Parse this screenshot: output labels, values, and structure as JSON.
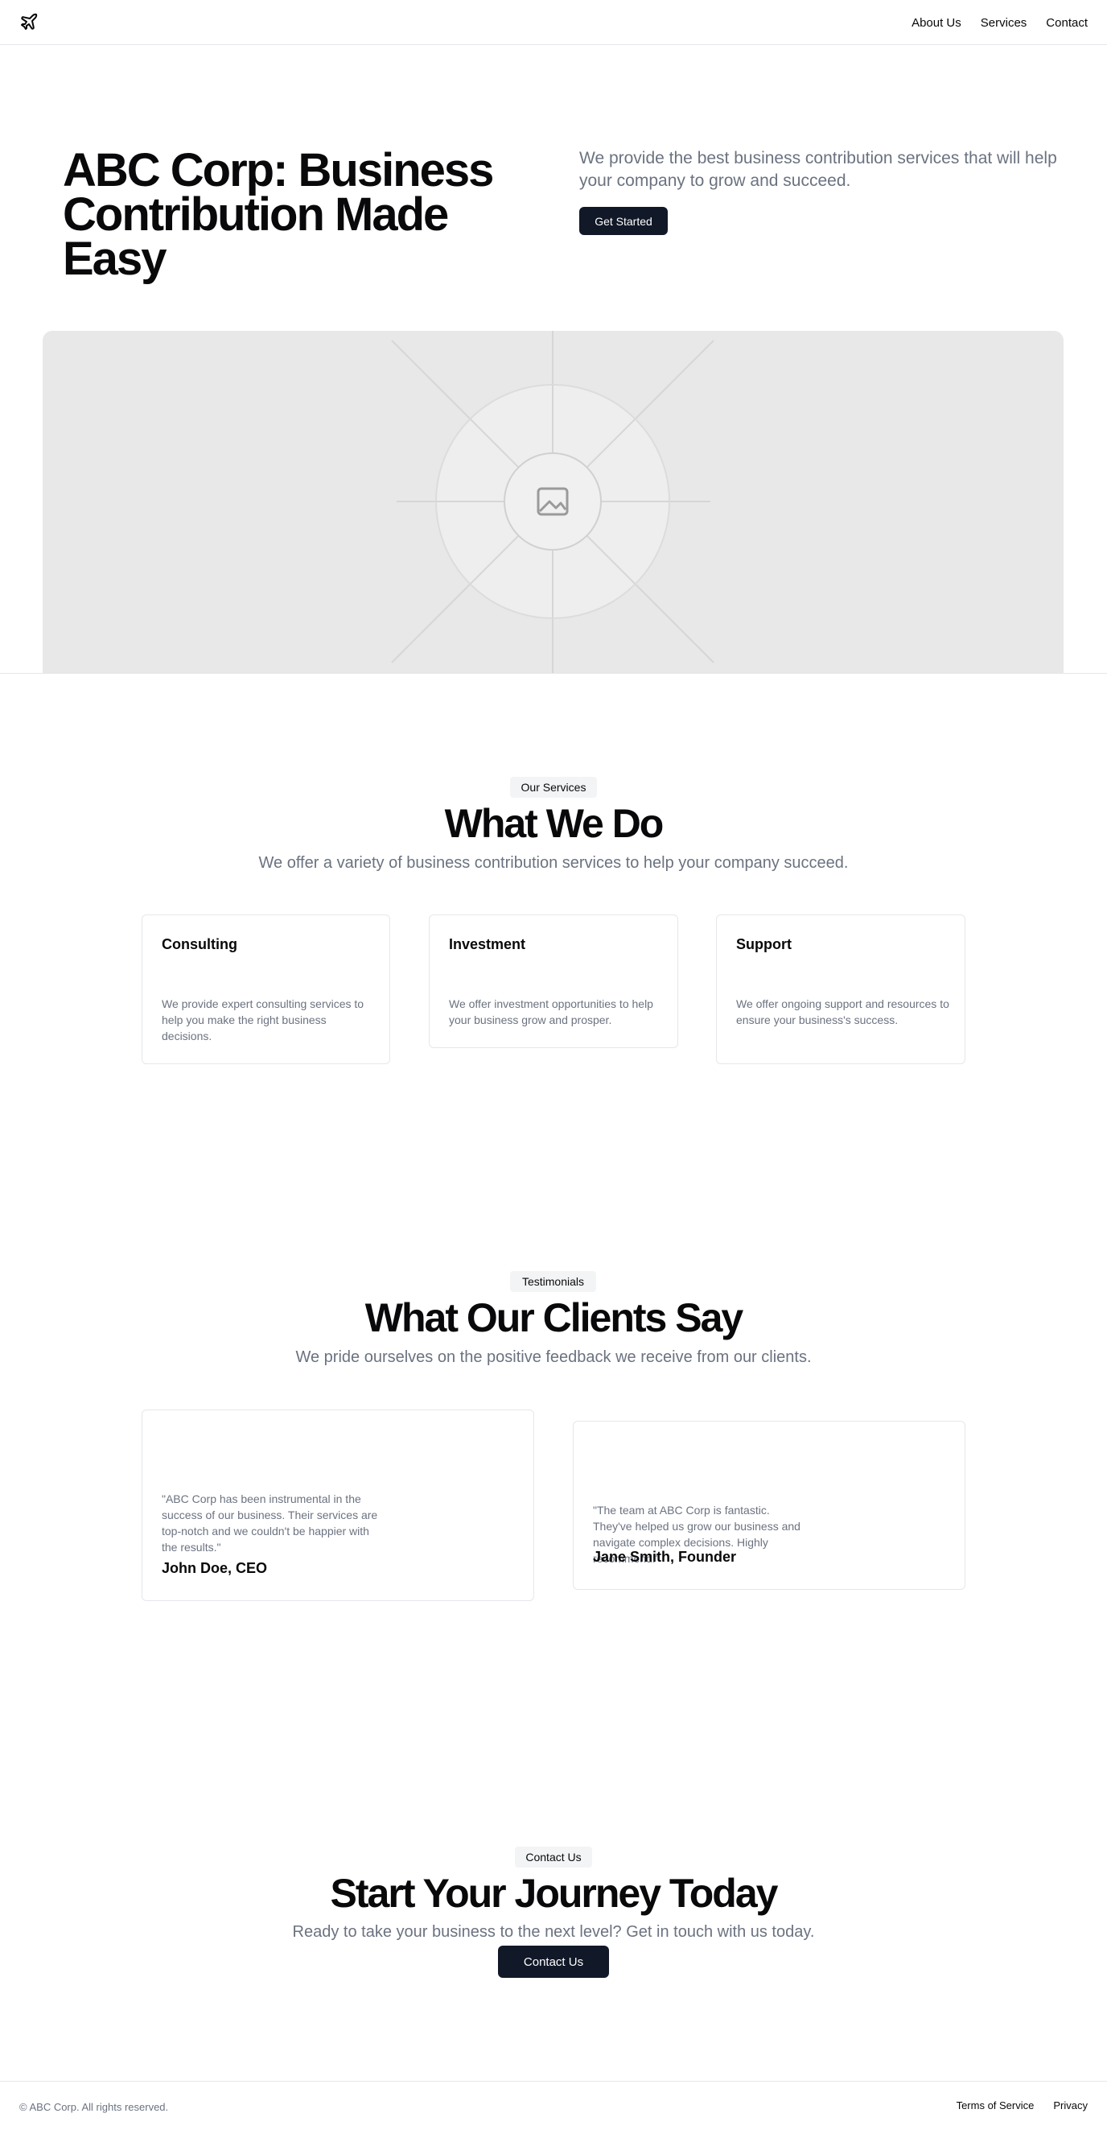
{
  "header": {
    "nav": [
      "About Us",
      "Services",
      "Contact"
    ]
  },
  "hero": {
    "title": "ABC Corp: Business Contribution Made Easy",
    "description": "We provide the best business contribution services that will help your company to grow and succeed.",
    "cta": "Get Started"
  },
  "services": {
    "badge": "Our Services",
    "title": "What We Do",
    "subtitle": "We offer a variety of business contribution services to help your company succeed.",
    "cards": [
      {
        "title": "Consulting",
        "text": "We provide expert consulting services to help you make the right business decisions."
      },
      {
        "title": "Investment",
        "text": "We offer investment opportunities to help your business grow and prosper."
      },
      {
        "title": "Support",
        "text": "We offer ongoing support and resources to ensure your business's success."
      }
    ]
  },
  "testimonials": {
    "badge": "Testimonials",
    "title": "What Our Clients Say",
    "subtitle": "We pride ourselves on the positive feedback we receive from our clients.",
    "items": [
      {
        "quote": "\"ABC Corp has been instrumental in the success of our business. Their services are top-notch and we couldn't be happier with the results.\"",
        "author": "John Doe, CEO"
      },
      {
        "quote": "\"The team at ABC Corp is fantastic. They've helped us grow our business and navigate complex decisions. Highly recommend!\"",
        "author": "Jane Smith, Founder"
      }
    ]
  },
  "contact": {
    "badge": "Contact Us",
    "title": "Start Your Journey Today",
    "subtitle": "Ready to take your business to the next level? Get in touch with us today.",
    "cta": "Contact Us"
  },
  "footer": {
    "copyright": "© ABC Corp. All rights reserved.",
    "links": [
      "Terms of Service",
      "Privacy"
    ]
  },
  "colors": {
    "primary": "#111827",
    "muted": "#6b7280",
    "border": "#e5e7eb",
    "badge_bg": "#f3f4f6"
  },
  "icons": {
    "logo": "plane-icon",
    "hero_image": "image-placeholder-icon"
  }
}
